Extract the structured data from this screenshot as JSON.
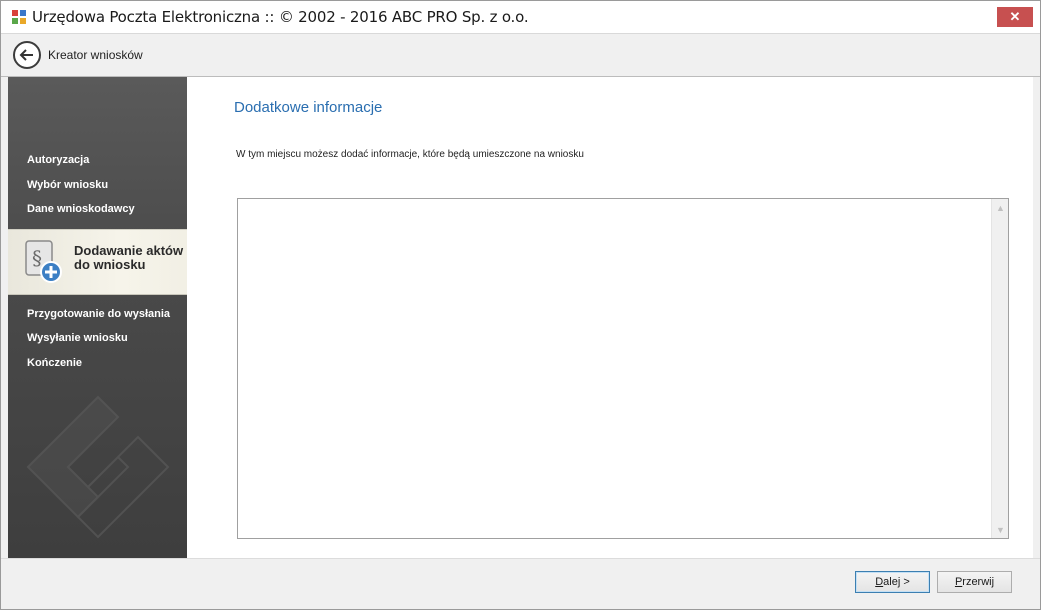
{
  "window": {
    "title": "Urzędowa Poczta Elektroniczna :: © 2002 - 2016 ABC PRO Sp. z o.o.",
    "close_label": "✕"
  },
  "navbar": {
    "title": "Kreator wniosków"
  },
  "sidebar": {
    "items_before": [
      {
        "label": "Autoryzacja"
      },
      {
        "label": "Wybór wniosku"
      },
      {
        "label": "Dane wnioskodawcy"
      }
    ],
    "active": {
      "label_line1": "Dodawanie aktów",
      "label_line2": "do wniosku",
      "icon": "document-paragraph-add-icon"
    },
    "items_after": [
      {
        "label": "Przygotowanie do wysłania"
      },
      {
        "label": "Wysyłanie wniosku"
      },
      {
        "label": "Kończenie"
      }
    ]
  },
  "content": {
    "heading": "Dodatkowe informacje",
    "description": "W tym miejscu możesz dodać informacje, które będą umieszczone na wniosku",
    "textarea_value": ""
  },
  "footer": {
    "next_label_underline": "D",
    "next_label_rest": "alej >",
    "cancel_label_underline": "P",
    "cancel_label_rest": "rzerwij"
  },
  "colors": {
    "heading": "#2a6eb0",
    "close_button": "#c75050",
    "sidebar": "#4a4a4a",
    "active_item": "#f3f1e7"
  }
}
